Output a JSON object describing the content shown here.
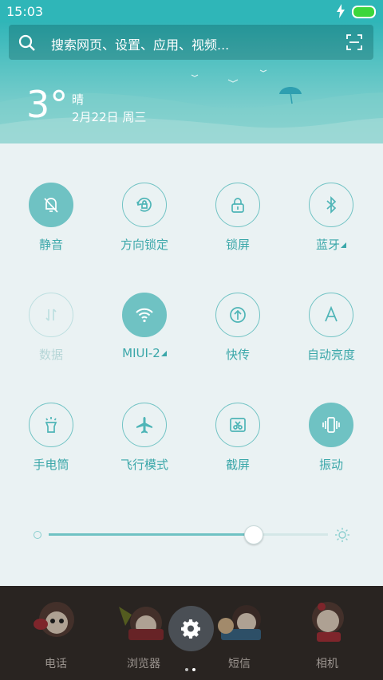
{
  "status_bar": {
    "time": "15:03",
    "charging_icon": "bolt-icon",
    "battery_color": "#3cd63c"
  },
  "search": {
    "placeholder": "搜索网页、设置、应用、视频..."
  },
  "weather": {
    "temperature": "3°",
    "condition": "晴",
    "date": "2月22日 周三"
  },
  "toggles": [
    {
      "label": "静音",
      "icon": "bell-off-icon",
      "state": "on"
    },
    {
      "label": "方向锁定",
      "icon": "rotation-lock-icon",
      "state": "off"
    },
    {
      "label": "锁屏",
      "icon": "lock-icon",
      "state": "off"
    },
    {
      "label": "蓝牙",
      "icon": "bluetooth-icon",
      "state": "off"
    },
    {
      "label": "数据",
      "icon": "mobile-data-icon",
      "state": "disabled"
    },
    {
      "label": "MIUI-2",
      "icon": "wifi-icon",
      "state": "on"
    },
    {
      "label": "快传",
      "icon": "share-upload-icon",
      "state": "off"
    },
    {
      "label": "自动亮度",
      "icon": "auto-brightness-icon",
      "state": "off"
    },
    {
      "label": "手电筒",
      "icon": "flashlight-icon",
      "state": "off"
    },
    {
      "label": "飞行模式",
      "icon": "airplane-icon",
      "state": "off"
    },
    {
      "label": "截屏",
      "icon": "screenshot-icon",
      "state": "off"
    },
    {
      "label": "振动",
      "icon": "vibrate-icon",
      "state": "on"
    }
  ],
  "brightness": {
    "level": 0.73
  },
  "dock": {
    "apps": [
      {
        "label": "电话"
      },
      {
        "label": "浏览器"
      },
      {
        "label": "短信"
      },
      {
        "label": "相机"
      }
    ],
    "page_count": 2,
    "current_page": 2
  },
  "colors": {
    "accent": "#6fc2c3",
    "accent_text": "#3ba7a9",
    "panel_bg": "#eaf2f3"
  }
}
